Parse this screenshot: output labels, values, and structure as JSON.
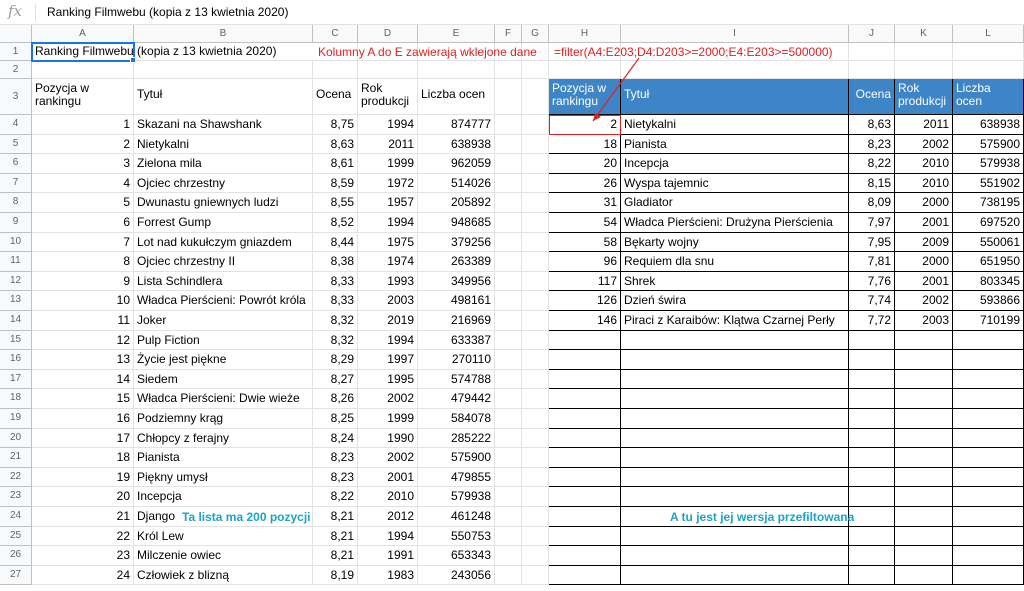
{
  "formula_bar": {
    "icon": "fx-icon",
    "text": "Ranking Filmwebu (kopia z 13 kwietnia 2020)"
  },
  "columns": [
    "A",
    "B",
    "C",
    "D",
    "E",
    "F",
    "G",
    "H",
    "I",
    "J",
    "K",
    "L"
  ],
  "rows": [
    "1",
    "2",
    "3",
    "4",
    "5",
    "6",
    "7",
    "8",
    "9",
    "10",
    "11",
    "12",
    "13",
    "14",
    "15",
    "16",
    "17",
    "18",
    "19",
    "20",
    "21",
    "22",
    "23",
    "24",
    "25",
    "26",
    "27"
  ],
  "title_cell": "Ranking Filmwebu (kopia z 13 kwietnia 2020)",
  "note_columns": "Kolumny A do E zawierają wklejone dane",
  "formula_note": "=filter(A4:E203;D4:D203>=2000;E4:E203>=500000)",
  "note_list": "Ta lista ma 200 pozycji",
  "note_filtered": "A tu jest jej wersja przefiltowana",
  "left_headers": {
    "pos": "Pozycja w rankingu",
    "title": "Tytuł",
    "score": "Ocena",
    "year": "Rok produkcji",
    "count": "Liczba ocen"
  },
  "right_headers": {
    "pos": "Pozycja w rankingu",
    "title": "Tytuł",
    "score": "Ocena",
    "year": "Rok produkcji",
    "count": "Liczba ocen"
  },
  "left_rows": [
    [
      "1",
      "Skazani na Shawshank",
      "8,75",
      "1994",
      "874777"
    ],
    [
      "2",
      "Nietykalni",
      "8,63",
      "2011",
      "638938"
    ],
    [
      "3",
      "Zielona mila",
      "8,61",
      "1999",
      "962059"
    ],
    [
      "4",
      "Ojciec chrzestny",
      "8,59",
      "1972",
      "514026"
    ],
    [
      "5",
      "Dwunastu gniewnych ludzi",
      "8,55",
      "1957",
      "205892"
    ],
    [
      "6",
      "Forrest Gump",
      "8,52",
      "1994",
      "948685"
    ],
    [
      "7",
      "Lot nad kukułczym gniazdem",
      "8,44",
      "1975",
      "379256"
    ],
    [
      "8",
      "Ojciec chrzestny II",
      "8,38",
      "1974",
      "263389"
    ],
    [
      "9",
      "Lista Schindlera",
      "8,33",
      "1993",
      "349956"
    ],
    [
      "10",
      "Władca Pierścieni: Powrót króla",
      "8,33",
      "2003",
      "498161"
    ],
    [
      "11",
      "Joker",
      "8,32",
      "2019",
      "216969"
    ],
    [
      "12",
      "Pulp Fiction",
      "8,32",
      "1994",
      "633387"
    ],
    [
      "13",
      "Życie jest piękne",
      "8,29",
      "1997",
      "270110"
    ],
    [
      "14",
      "Siedem",
      "8,27",
      "1995",
      "574788"
    ],
    [
      "15",
      "Władca Pierścieni: Dwie wieże",
      "8,26",
      "2002",
      "479442"
    ],
    [
      "16",
      "Podziemny krąg",
      "8,25",
      "1999",
      "584078"
    ],
    [
      "17",
      "Chłopcy z ferajny",
      "8,24",
      "1990",
      "285222"
    ],
    [
      "18",
      "Pianista",
      "8,23",
      "2002",
      "575900"
    ],
    [
      "19",
      "Piękny umysł",
      "8,23",
      "2001",
      "479855"
    ],
    [
      "20",
      "Incepcja",
      "8,22",
      "2010",
      "579938"
    ],
    [
      "21",
      "Django",
      "8,21",
      "2012",
      "461248"
    ],
    [
      "22",
      "Król Lew",
      "8,21",
      "1994",
      "550753"
    ],
    [
      "23",
      "Milczenie owiec",
      "8,21",
      "1991",
      "653343"
    ],
    [
      "24",
      "Człowiek z blizną",
      "8,19",
      "1983",
      "243056"
    ]
  ],
  "right_rows": [
    [
      "2",
      "Nietykalni",
      "8,63",
      "2011",
      "638938"
    ],
    [
      "18",
      "Pianista",
      "8,23",
      "2002",
      "575900"
    ],
    [
      "20",
      "Incepcja",
      "8,22",
      "2010",
      "579938"
    ],
    [
      "26",
      "Wyspa tajemnic",
      "8,15",
      "2010",
      "551902"
    ],
    [
      "31",
      "Gladiator",
      "8,09",
      "2000",
      "738195"
    ],
    [
      "54",
      "Władca Pierścieni: Drużyna Pierścienia",
      "7,97",
      "2001",
      "697520"
    ],
    [
      "58",
      "Bękarty wojny",
      "7,95",
      "2009",
      "550061"
    ],
    [
      "96",
      "Requiem dla snu",
      "7,81",
      "2000",
      "651950"
    ],
    [
      "117",
      "Shrek",
      "7,76",
      "2001",
      "803345"
    ],
    [
      "126",
      "Dzień świra",
      "7,74",
      "2002",
      "593866"
    ],
    [
      "146",
      "Piraci z Karaibów: Klątwa Czarnej Perły",
      "7,72",
      "2003",
      "710199"
    ]
  ]
}
